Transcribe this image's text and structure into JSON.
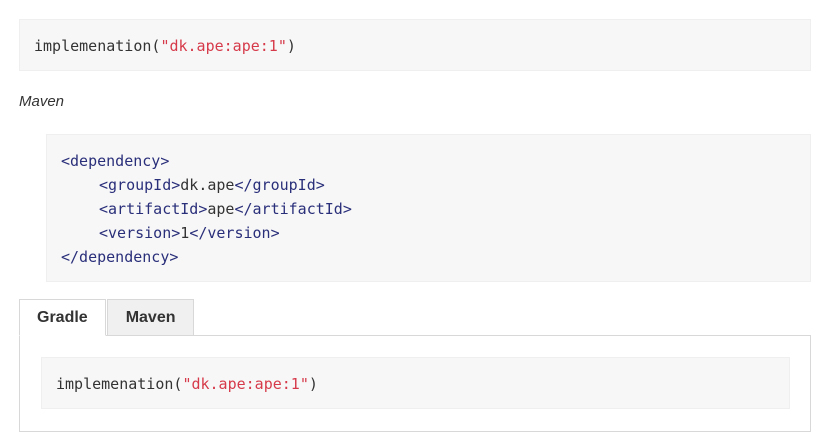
{
  "gradle_snippet": {
    "func": "implemenation(",
    "arg": "\"dk.ape:ape:1\"",
    "close": ")"
  },
  "maven_label": "Maven",
  "maven_snippet": {
    "dependency_open": "<dependency>",
    "group_open": "<groupId>",
    "group_value": "dk.ape",
    "group_close": "</groupId>",
    "artifact_open": "<artifactId>",
    "artifact_value": "ape",
    "artifact_close": "</artifactId>",
    "version_open": "<version>",
    "version_value": "1",
    "version_close": "</version>",
    "dependency_close": "</dependency>"
  },
  "tabs": [
    {
      "label": "Gradle",
      "active": true
    },
    {
      "label": "Maven",
      "active": false
    }
  ],
  "tab_panel_snippet": {
    "func": "implemenation(",
    "arg": "\"dk.ape:ape:1\"",
    "close": ")"
  },
  "colors": {
    "string": "#d63a4a",
    "tag": "#2a2f7a",
    "code_background": "#f7f7f7"
  }
}
